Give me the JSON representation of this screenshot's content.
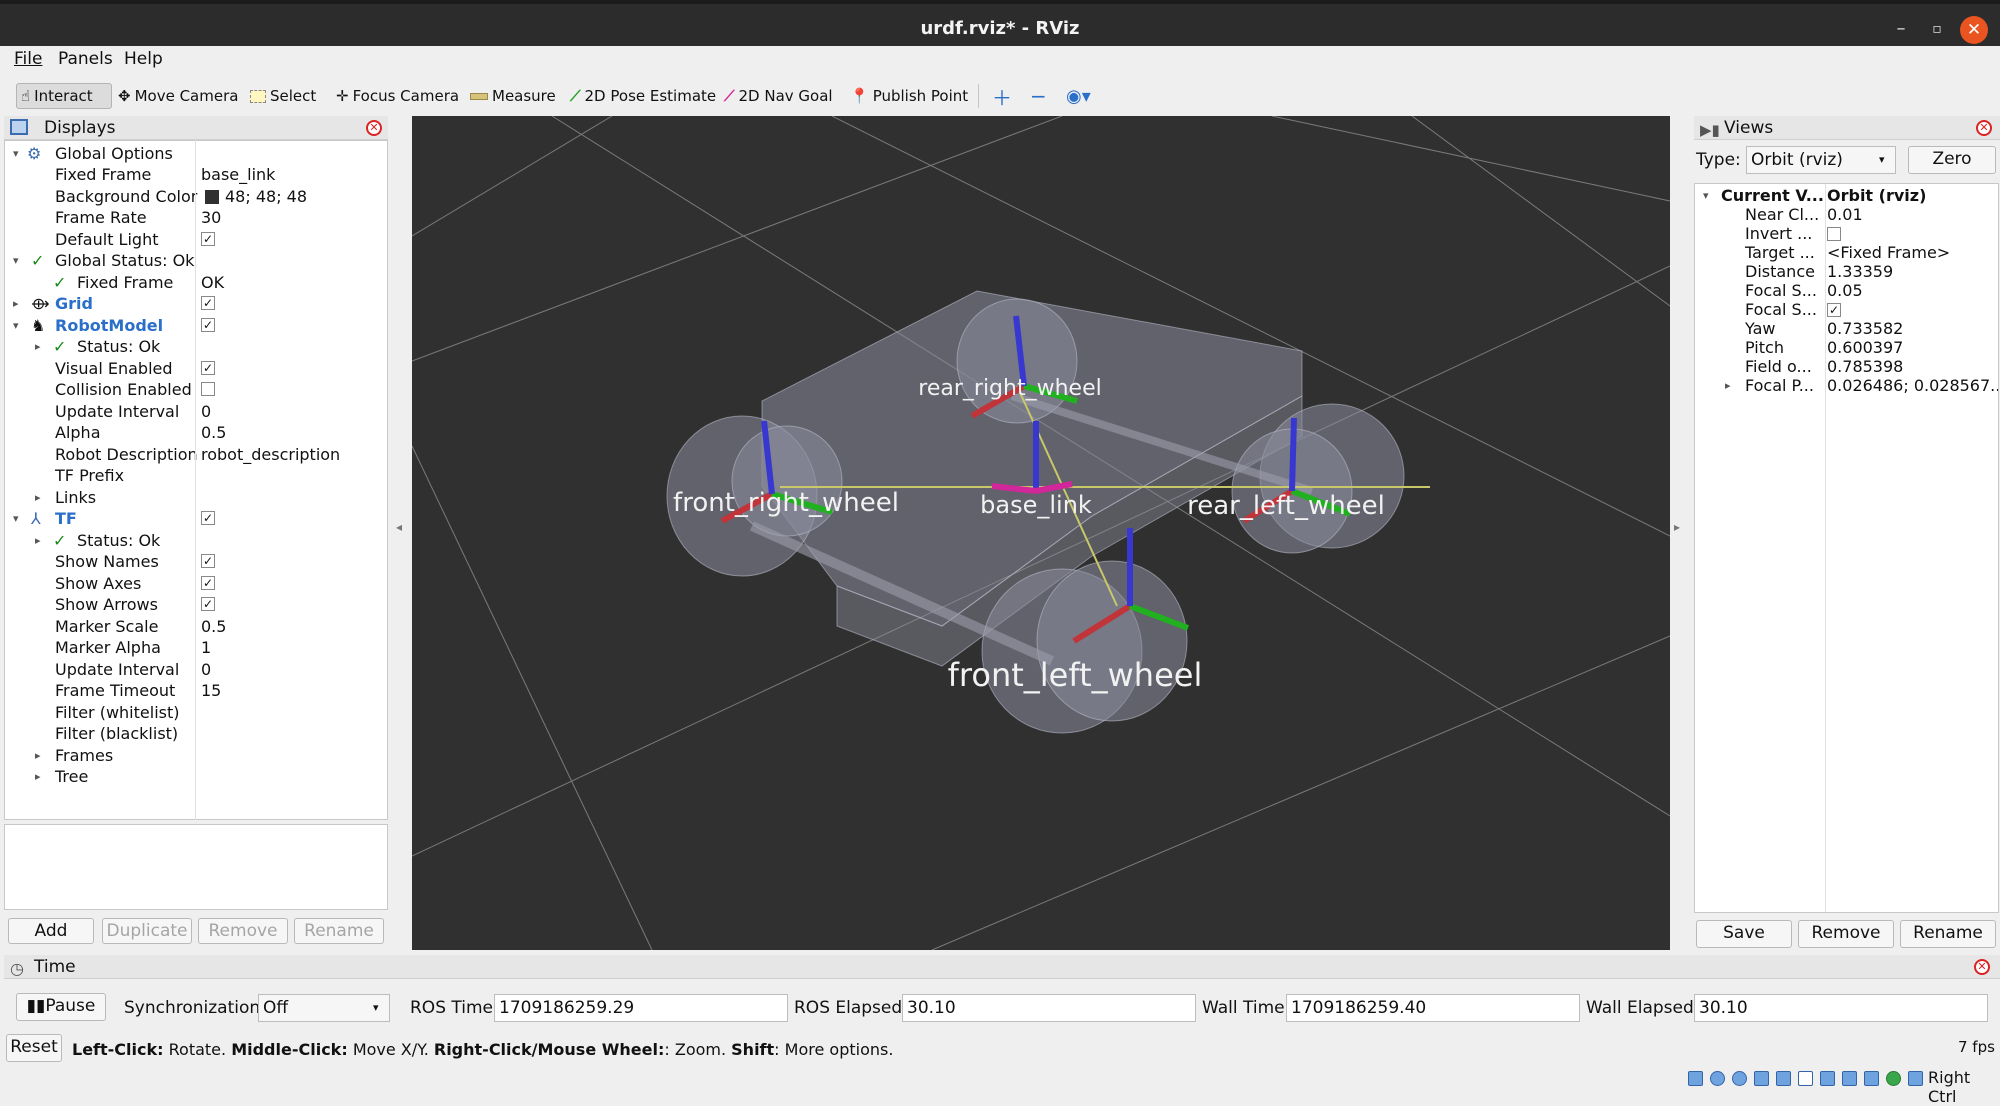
{
  "window": {
    "title": "urdf.rviz* - RViz"
  },
  "menu": [
    "File",
    "Panels",
    "Help"
  ],
  "toolbar": {
    "interact": "Interact",
    "move_camera": "Move Camera",
    "select": "Select",
    "focus_camera": "Focus Camera",
    "measure": "Measure",
    "pose_estimate": "2D Pose Estimate",
    "nav_goal": "2D Nav Goal",
    "publish_point": "Publish Point"
  },
  "displays": {
    "title": "Displays",
    "rows": [
      {
        "label": "Global Options",
        "value": ""
      },
      {
        "label": "Fixed Frame",
        "value": "base_link"
      },
      {
        "label": "Background Color",
        "value": "48; 48; 48"
      },
      {
        "label": "Frame Rate",
        "value": "30"
      },
      {
        "label": "Default Light",
        "value": ""
      },
      {
        "label": "Global Status: Ok",
        "value": ""
      },
      {
        "label": "Fixed Frame",
        "value": "OK"
      },
      {
        "label": "Grid",
        "value": ""
      },
      {
        "label": "RobotModel",
        "value": ""
      },
      {
        "label": "Status: Ok",
        "value": ""
      },
      {
        "label": "Visual Enabled",
        "value": ""
      },
      {
        "label": "Collision Enabled",
        "value": ""
      },
      {
        "label": "Update Interval",
        "value": "0"
      },
      {
        "label": "Alpha",
        "value": "0.5"
      },
      {
        "label": "Robot Description",
        "value": "robot_description"
      },
      {
        "label": "TF Prefix",
        "value": ""
      },
      {
        "label": "Links",
        "value": ""
      },
      {
        "label": "TF",
        "value": ""
      },
      {
        "label": "Status: Ok",
        "value": ""
      },
      {
        "label": "Show Names",
        "value": ""
      },
      {
        "label": "Show Axes",
        "value": ""
      },
      {
        "label": "Show Arrows",
        "value": ""
      },
      {
        "label": "Marker Scale",
        "value": "0.5"
      },
      {
        "label": "Marker Alpha",
        "value": "1"
      },
      {
        "label": "Update Interval",
        "value": "0"
      },
      {
        "label": "Frame Timeout",
        "value": "15"
      },
      {
        "label": "Filter (whitelist)",
        "value": ""
      },
      {
        "label": "Filter (blacklist)",
        "value": ""
      },
      {
        "label": "Frames",
        "value": ""
      },
      {
        "label": "Tree",
        "value": ""
      }
    ],
    "buttons": {
      "add": "Add",
      "duplicate": "Duplicate",
      "remove": "Remove",
      "rename": "Rename"
    }
  },
  "scene": {
    "frame_labels": {
      "rear_right": "rear_right_wheel",
      "front_right": "front_right_wheel",
      "base": "base_link",
      "rear_left": "rear_left_wheel",
      "front_left": "front_left_wheel"
    }
  },
  "views": {
    "title": "Views",
    "type_label": "Type:",
    "type_value": "Orbit (rviz)",
    "zero": "Zero",
    "rows": [
      {
        "label": "Current V...",
        "value": "Orbit (rviz)"
      },
      {
        "label": "Near Cl...",
        "value": "0.01"
      },
      {
        "label": "Invert ...",
        "value": ""
      },
      {
        "label": "Target ...",
        "value": "<Fixed Frame>"
      },
      {
        "label": "Distance",
        "value": "1.33359"
      },
      {
        "label": "Focal S...",
        "value": "0.05"
      },
      {
        "label": "Focal S...",
        "value": ""
      },
      {
        "label": "Yaw",
        "value": "0.733582"
      },
      {
        "label": "Pitch",
        "value": "0.600397"
      },
      {
        "label": "Field o...",
        "value": "0.785398"
      },
      {
        "label": "Focal P...",
        "value": "0.026486; 0.028567..."
      }
    ],
    "buttons": {
      "save": "Save",
      "remove": "Remove",
      "rename": "Rename"
    }
  },
  "time": {
    "title": "Time",
    "pause": "Pause",
    "sync_label": "Synchronization:",
    "sync_value": "Off",
    "ros_time_label": "ROS Time:",
    "ros_time": "1709186259.29",
    "ros_elapsed_label": "ROS Elapsed:",
    "ros_elapsed": "30.10",
    "wall_time_label": "Wall Time:",
    "wall_time": "1709186259.40",
    "wall_elapsed_label": "Wall Elapsed:",
    "wall_elapsed": "30.10"
  },
  "status": {
    "reset": "Reset",
    "left_click": "Left-Click:",
    "left_click_desc": "Rotate.",
    "middle_click": "Middle-Click:",
    "middle_click_desc": "Move X/Y.",
    "right_click": "Right-Click/Mouse Wheel:",
    "right_click_desc": ": Zoom.",
    "shift": "Shift",
    "shift_desc": ": More options.",
    "fps": "7 fps",
    "tray_text": "Right Ctrl"
  },
  "colors": {
    "background": "#303030",
    "accent": "#2a6fc9",
    "close": "#e95420"
  }
}
